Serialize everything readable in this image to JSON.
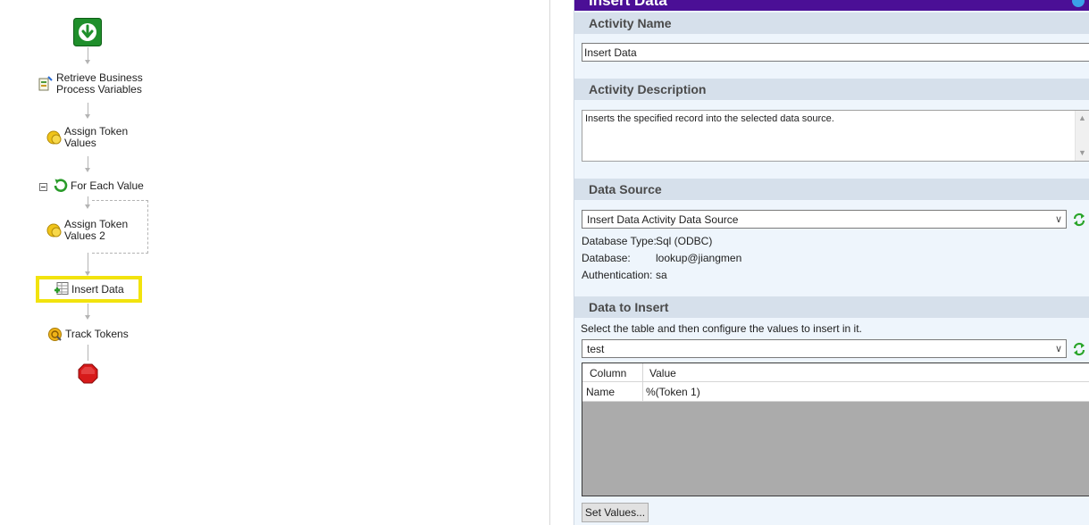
{
  "workflow": {
    "nodes": [
      {
        "label": "Retrieve Business\nProcess Variables",
        "icon": "variables-icon"
      },
      {
        "label": "Assign Token\nValues",
        "icon": "token-icon"
      },
      {
        "label": "For Each Value",
        "icon": "loop-icon"
      },
      {
        "label": "Assign Token\nValues 2",
        "icon": "token-icon"
      },
      {
        "label": "Insert Data",
        "icon": "insert-data-icon",
        "selected": true
      },
      {
        "label": "Track Tokens",
        "icon": "track-tokens-icon"
      }
    ],
    "start_icon": "start-arrow-icon",
    "end_icon": "stop-icon",
    "selected_color": "#f2e30d"
  },
  "panel": {
    "title": "Insert Data",
    "header_color": "#4b0f96",
    "activity_name": {
      "heading": "Activity Name",
      "value": "Insert Data"
    },
    "activity_description": {
      "heading": "Activity Description",
      "value": "Inserts the specified record into the selected data source."
    },
    "data_source": {
      "heading": "Data Source",
      "selected": "Insert Data Activity Data Source",
      "database_type_label": "Database Type:",
      "database_type_value": "Sql (ODBC)",
      "database_label": "Database:",
      "database_value": "lookup@jiangmen",
      "authentication_label": "Authentication:",
      "authentication_value": "sa"
    },
    "data_to_insert": {
      "heading": "Data to Insert",
      "instruction": "Select the table and then configure the values to insert in it.",
      "table_selected": "test",
      "columns": [
        "Column",
        "Value"
      ],
      "rows": [
        {
          "column": "Name",
          "value": "%(Token 1)"
        }
      ],
      "set_values_label": "Set Values..."
    }
  }
}
